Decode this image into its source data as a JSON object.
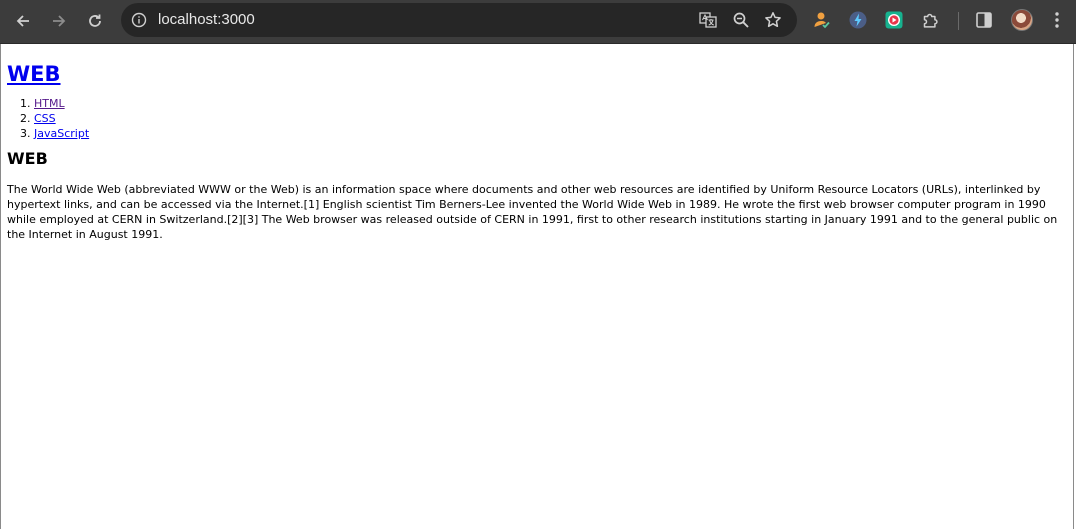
{
  "browser": {
    "url": "localhost:3000",
    "icons": {
      "back": "arrow-left-icon",
      "forward": "arrow-right-icon",
      "reload": "reload-icon",
      "info": "info-icon",
      "translate": "translate-icon",
      "zoom": "zoom-icon",
      "bookmark": "star-icon",
      "extensions": "puzzle-icon",
      "side_panel": "side-panel-icon",
      "menu": "kebab-menu-icon"
    },
    "colors": {
      "toolbar": "#3c3c3c",
      "omnibox": "#262626",
      "url_text": "#e8e8e8"
    }
  },
  "page": {
    "title": "WEB",
    "nav": [
      "HTML",
      "CSS",
      "JavaScript"
    ],
    "section_title": "WEB",
    "body": "The World Wide Web (abbreviated WWW or the Web) is an information space where documents and other web resources are identified by Uniform Resource Locators (URLs), interlinked by hypertext links, and can be accessed via the Internet.[1] English scientist Tim Berners-Lee invented the World Wide Web in 1989. He wrote the first web browser computer program in 1990 while employed at CERN in Switzerland.[2][3] The Web browser was released outside of CERN in 1991, first to other research institutions starting in January 1991 and to the general public on the Internet in August 1991.",
    "link_color": "#0000ee",
    "visited_link_color": "#551a8b"
  }
}
